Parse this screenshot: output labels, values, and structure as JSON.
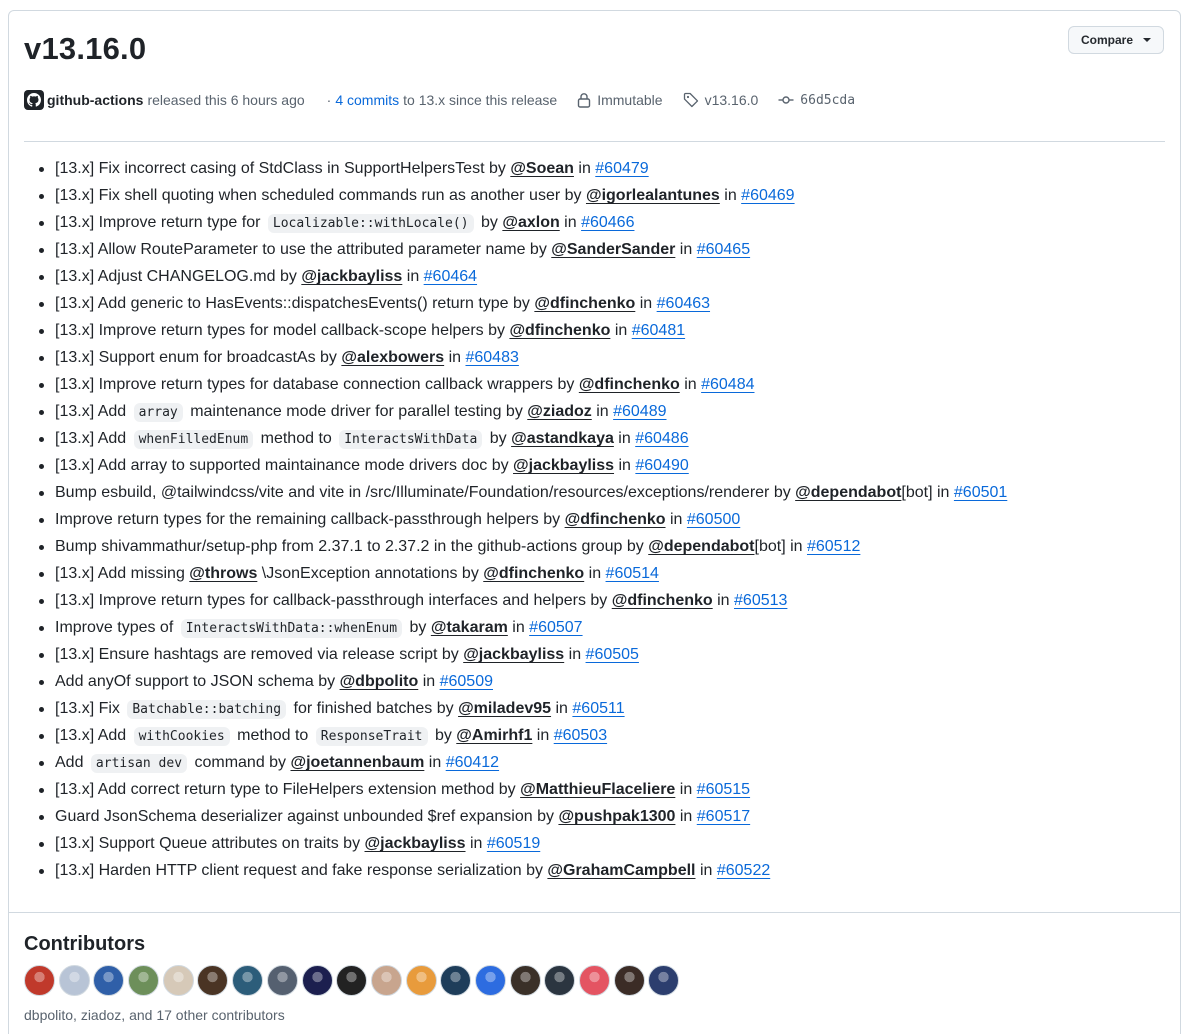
{
  "release": {
    "title": "v13.16.0",
    "compare_label": "Compare",
    "author": "github-actions",
    "released_text": "released this 6 hours ago",
    "commits_link": "4 commits",
    "commits_suffix": "to 13.x since this release",
    "immutable_label": "Immutable",
    "tag": "v13.16.0",
    "commit_sha": "66d5cda"
  },
  "notes": [
    {
      "parts": [
        {
          "t": "text",
          "v": "[13.x] Fix incorrect casing of StdClass in SupportHelpersTest by "
        },
        {
          "t": "user",
          "v": "@Soean"
        },
        {
          "t": "text",
          "v": " in "
        },
        {
          "t": "pr",
          "v": "#60479"
        }
      ]
    },
    {
      "parts": [
        {
          "t": "text",
          "v": "[13.x] Fix shell quoting when scheduled commands run as another user by "
        },
        {
          "t": "user",
          "v": "@igorlealantunes"
        },
        {
          "t": "text",
          "v": " in "
        },
        {
          "t": "pr",
          "v": "#60469"
        }
      ]
    },
    {
      "parts": [
        {
          "t": "text",
          "v": "[13.x] Improve return type for "
        },
        {
          "t": "code",
          "v": "Localizable::withLocale()"
        },
        {
          "t": "text",
          "v": " by "
        },
        {
          "t": "user",
          "v": "@axlon"
        },
        {
          "t": "text",
          "v": " in "
        },
        {
          "t": "pr",
          "v": "#60466"
        }
      ]
    },
    {
      "parts": [
        {
          "t": "text",
          "v": "[13.x] Allow RouteParameter to use the attributed parameter name by "
        },
        {
          "t": "user",
          "v": "@SanderSander"
        },
        {
          "t": "text",
          "v": " in "
        },
        {
          "t": "pr",
          "v": "#60465"
        }
      ]
    },
    {
      "parts": [
        {
          "t": "text",
          "v": "[13.x] Adjust CHANGELOG.md by "
        },
        {
          "t": "user",
          "v": "@jackbayliss"
        },
        {
          "t": "text",
          "v": " in "
        },
        {
          "t": "pr",
          "v": "#60464"
        }
      ]
    },
    {
      "parts": [
        {
          "t": "text",
          "v": "[13.x] Add generic to HasEvents::dispatchesEvents() return type by "
        },
        {
          "t": "user",
          "v": "@dfinchenko"
        },
        {
          "t": "text",
          "v": " in "
        },
        {
          "t": "pr",
          "v": "#60463"
        }
      ]
    },
    {
      "parts": [
        {
          "t": "text",
          "v": "[13.x] Improve return types for model callback-scope helpers by "
        },
        {
          "t": "user",
          "v": "@dfinchenko"
        },
        {
          "t": "text",
          "v": " in "
        },
        {
          "t": "pr",
          "v": "#60481"
        }
      ]
    },
    {
      "parts": [
        {
          "t": "text",
          "v": "[13.x] Support enum for broadcastAs by "
        },
        {
          "t": "user",
          "v": "@alexbowers"
        },
        {
          "t": "text",
          "v": " in "
        },
        {
          "t": "pr",
          "v": "#60483"
        }
      ]
    },
    {
      "parts": [
        {
          "t": "text",
          "v": "[13.x] Improve return types for database connection callback wrappers by "
        },
        {
          "t": "user",
          "v": "@dfinchenko"
        },
        {
          "t": "text",
          "v": " in "
        },
        {
          "t": "pr",
          "v": "#60484"
        }
      ]
    },
    {
      "parts": [
        {
          "t": "text",
          "v": "[13.x] Add "
        },
        {
          "t": "code",
          "v": "array"
        },
        {
          "t": "text",
          "v": " maintenance mode driver for parallel testing by "
        },
        {
          "t": "user",
          "v": "@ziadoz"
        },
        {
          "t": "text",
          "v": " in "
        },
        {
          "t": "pr",
          "v": "#60489"
        }
      ]
    },
    {
      "parts": [
        {
          "t": "text",
          "v": "[13.x] Add "
        },
        {
          "t": "code",
          "v": "whenFilledEnum"
        },
        {
          "t": "text",
          "v": " method to "
        },
        {
          "t": "code",
          "v": "InteractsWithData"
        },
        {
          "t": "text",
          "v": " by "
        },
        {
          "t": "user",
          "v": "@astandkaya"
        },
        {
          "t": "text",
          "v": " in "
        },
        {
          "t": "pr",
          "v": "#60486"
        }
      ]
    },
    {
      "parts": [
        {
          "t": "text",
          "v": "[13.x] Add array to supported maintainance mode drivers doc by "
        },
        {
          "t": "user",
          "v": "@jackbayliss"
        },
        {
          "t": "text",
          "v": " in "
        },
        {
          "t": "pr",
          "v": "#60490"
        }
      ]
    },
    {
      "parts": [
        {
          "t": "text",
          "v": "Bump esbuild, @tailwindcss/vite and vite in /src/Illuminate/Foundation/resources/exceptions/renderer by "
        },
        {
          "t": "user",
          "v": "@dependabot"
        },
        {
          "t": "text",
          "v": "[bot] in "
        },
        {
          "t": "pr",
          "v": "#60501"
        }
      ]
    },
    {
      "parts": [
        {
          "t": "text",
          "v": "Improve return types for the remaining callback-passthrough helpers by "
        },
        {
          "t": "user",
          "v": "@dfinchenko"
        },
        {
          "t": "text",
          "v": " in "
        },
        {
          "t": "pr",
          "v": "#60500"
        }
      ]
    },
    {
      "parts": [
        {
          "t": "text",
          "v": "Bump shivammathur/setup-php from 2.37.1 to 2.37.2 in the github-actions group by "
        },
        {
          "t": "user",
          "v": "@dependabot"
        },
        {
          "t": "text",
          "v": "[bot] in "
        },
        {
          "t": "pr",
          "v": "#60512"
        }
      ]
    },
    {
      "parts": [
        {
          "t": "text",
          "v": "[13.x] Add missing "
        },
        {
          "t": "user",
          "v": "@throws"
        },
        {
          "t": "text",
          "v": " \\JsonException annotations by "
        },
        {
          "t": "user",
          "v": "@dfinchenko"
        },
        {
          "t": "text",
          "v": " in "
        },
        {
          "t": "pr",
          "v": "#60514"
        }
      ]
    },
    {
      "parts": [
        {
          "t": "text",
          "v": "[13.x] Improve return types for callback-passthrough interfaces and helpers by "
        },
        {
          "t": "user",
          "v": "@dfinchenko"
        },
        {
          "t": "text",
          "v": " in "
        },
        {
          "t": "pr",
          "v": "#60513"
        }
      ]
    },
    {
      "parts": [
        {
          "t": "text",
          "v": "Improve types of "
        },
        {
          "t": "code",
          "v": "InteractsWithData::whenEnum"
        },
        {
          "t": "text",
          "v": " by "
        },
        {
          "t": "user",
          "v": "@takaram"
        },
        {
          "t": "text",
          "v": " in "
        },
        {
          "t": "pr",
          "v": "#60507"
        }
      ]
    },
    {
      "parts": [
        {
          "t": "text",
          "v": "[13.x] Ensure hashtags are removed via release script by "
        },
        {
          "t": "user",
          "v": "@jackbayliss"
        },
        {
          "t": "text",
          "v": " in "
        },
        {
          "t": "pr",
          "v": "#60505"
        }
      ]
    },
    {
      "parts": [
        {
          "t": "text",
          "v": "Add anyOf support to JSON schema by "
        },
        {
          "t": "user",
          "v": "@dbpolito"
        },
        {
          "t": "text",
          "v": " in "
        },
        {
          "t": "pr",
          "v": "#60509"
        }
      ]
    },
    {
      "parts": [
        {
          "t": "text",
          "v": "[13.x] Fix "
        },
        {
          "t": "code",
          "v": "Batchable::batching"
        },
        {
          "t": "text",
          "v": " for finished batches by "
        },
        {
          "t": "user",
          "v": "@miladev95"
        },
        {
          "t": "text",
          "v": " in "
        },
        {
          "t": "pr",
          "v": "#60511"
        }
      ]
    },
    {
      "parts": [
        {
          "t": "text",
          "v": "[13.x] Add "
        },
        {
          "t": "code",
          "v": "withCookies"
        },
        {
          "t": "text",
          "v": " method to "
        },
        {
          "t": "code",
          "v": "ResponseTrait"
        },
        {
          "t": "text",
          "v": " by "
        },
        {
          "t": "user",
          "v": "@Amirhf1"
        },
        {
          "t": "text",
          "v": " in "
        },
        {
          "t": "pr",
          "v": "#60503"
        }
      ]
    },
    {
      "parts": [
        {
          "t": "text",
          "v": "Add "
        },
        {
          "t": "code",
          "v": "artisan dev"
        },
        {
          "t": "text",
          "v": " command by "
        },
        {
          "t": "user",
          "v": "@joetannenbaum"
        },
        {
          "t": "text",
          "v": " in "
        },
        {
          "t": "pr",
          "v": "#60412"
        }
      ]
    },
    {
      "parts": [
        {
          "t": "text",
          "v": "[13.x] Add correct return type to FileHelpers extension method by "
        },
        {
          "t": "user",
          "v": "@MatthieuFlaceliere"
        },
        {
          "t": "text",
          "v": " in "
        },
        {
          "t": "pr",
          "v": "#60515"
        }
      ]
    },
    {
      "parts": [
        {
          "t": "text",
          "v": "Guard JsonSchema deserializer against unbounded $ref expansion by "
        },
        {
          "t": "user",
          "v": "@pushpak1300"
        },
        {
          "t": "text",
          "v": " in "
        },
        {
          "t": "pr",
          "v": "#60517"
        }
      ]
    },
    {
      "parts": [
        {
          "t": "text",
          "v": "[13.x] Support Queue attributes on traits by "
        },
        {
          "t": "user",
          "v": "@jackbayliss"
        },
        {
          "t": "text",
          "v": " in "
        },
        {
          "t": "pr",
          "v": "#60519"
        }
      ]
    },
    {
      "parts": [
        {
          "t": "text",
          "v": "[13.x] Harden HTTP client request and fake response serialization by "
        },
        {
          "t": "user",
          "v": "@GrahamCampbell"
        },
        {
          "t": "text",
          "v": " in "
        },
        {
          "t": "pr",
          "v": "#60522"
        }
      ]
    }
  ],
  "contributors": {
    "title": "Contributors",
    "summary": "dbpolito, ziadoz, and 17 other contributors",
    "avatar_colors": [
      "#c0392b",
      "#b8c4d6",
      "#2f5fa8",
      "#6d8f5a",
      "#d6c9b8",
      "#4a3424",
      "#2c5d7a",
      "#556070",
      "#1c1f4f",
      "#222222",
      "#c8a58e",
      "#e89b3c",
      "#1e3d5a",
      "#2d6ce0",
      "#3a3028",
      "#2b3540",
      "#e45462",
      "#3b2c26",
      "#2c3e6e"
    ]
  },
  "colors": {
    "link": "#0969da",
    "text": "#1f2328",
    "muted": "#59636e",
    "border": "#d1d9e0"
  }
}
